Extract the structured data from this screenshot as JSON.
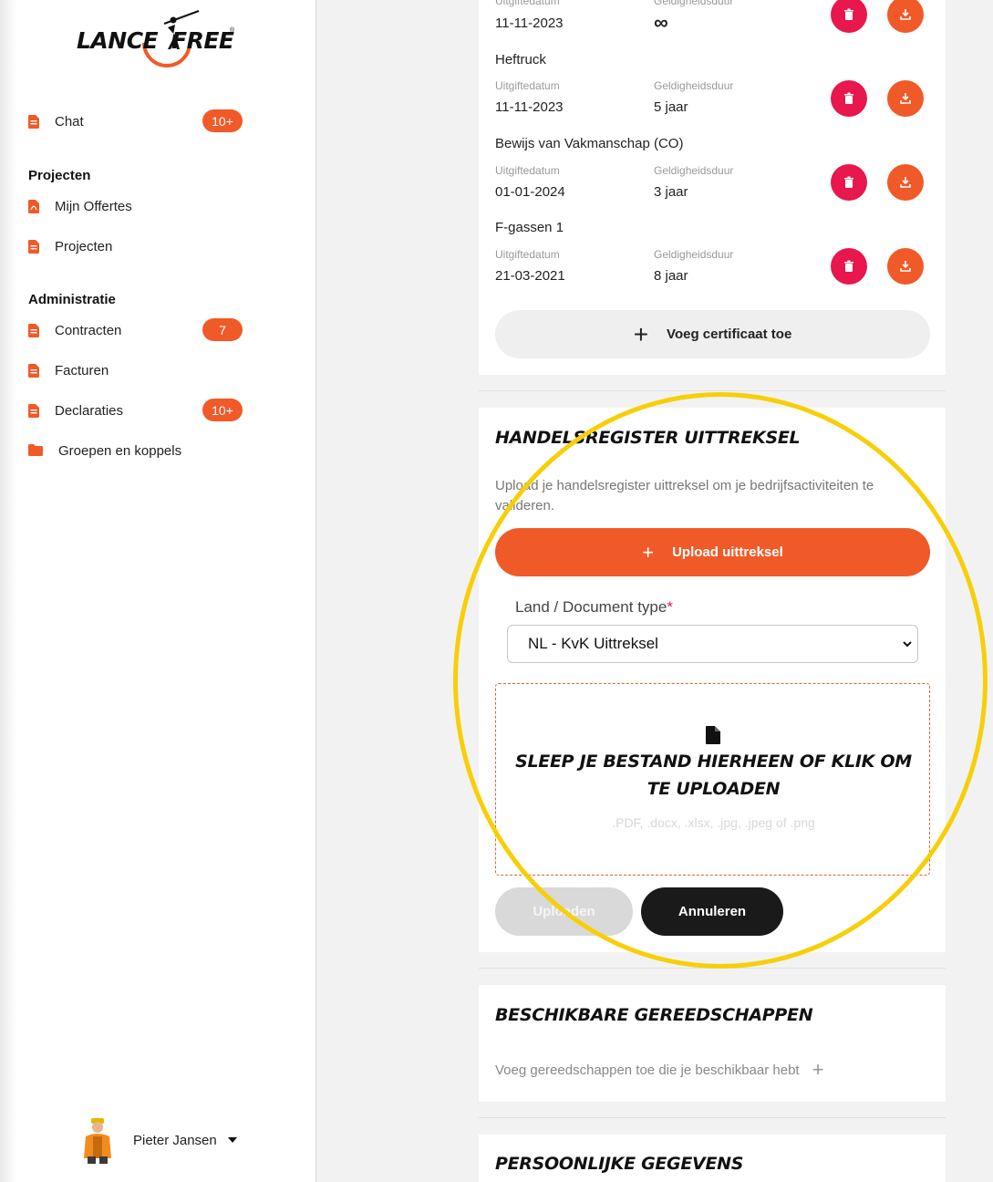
{
  "brand": {
    "left": "LANCE",
    "right": "FREE",
    "reg": "®",
    "accent": "#f05a28"
  },
  "sidebar": {
    "chat": {
      "label": "Chat",
      "badge": "10+"
    },
    "projects_section": "Projecten",
    "projects": [
      {
        "label": "Mijn Offertes"
      },
      {
        "label": "Projecten"
      }
    ],
    "admin_section": "Administratie",
    "admin": [
      {
        "label": "Contracten",
        "badge": "7"
      },
      {
        "label": "Facturen"
      },
      {
        "label": "Declaraties",
        "badge": "10+"
      }
    ],
    "groups": {
      "label": "Groepen en koppels"
    },
    "user": {
      "name": "Pieter Jansen"
    }
  },
  "certificates": {
    "issue_label": "Uitgiftedatum",
    "validity_label": "Geldigheidsduur",
    "items": [
      {
        "name": "",
        "issue": "11-11-2023",
        "validity": "∞"
      },
      {
        "name": "Heftruck",
        "issue": "11-11-2023",
        "validity": "5 jaar"
      },
      {
        "name": "Bewijs van Vakmanschap (CO)",
        "issue": "01-01-2024",
        "validity": "3 jaar"
      },
      {
        "name": "F-gassen 1",
        "issue": "21-03-2021",
        "validity": "8 jaar"
      }
    ],
    "add_label": "Voeg certificaat toe"
  },
  "trade_register": {
    "title": "HANDELSREGISTER UITTREKSEL",
    "description": "Upload je handelsregister uittreksel om je bedrijfsactiviteiten te valideren.",
    "upload_button": "Upload uittreksel",
    "field_label": "Land / Document type",
    "required_mark": "*",
    "select_value": "NL - KvK Uittreksel",
    "dropzone_title": "SLEEP JE BESTAND HIERHEEN OF KLIK OM TE UPLOADEN",
    "dropzone_hint": ".PDF, .docx, .xlsx, .jpg, .jpeg of .png",
    "submit_button": "Uploaden",
    "cancel_button": "Annuleren"
  },
  "tools": {
    "title": "BESCHIKBARE GEREEDSCHAPPEN",
    "text": "Voeg gereedschappen toe die je beschikbaar hebt"
  },
  "personal": {
    "title": "PERSOONLIJKE GEGEVENS"
  }
}
